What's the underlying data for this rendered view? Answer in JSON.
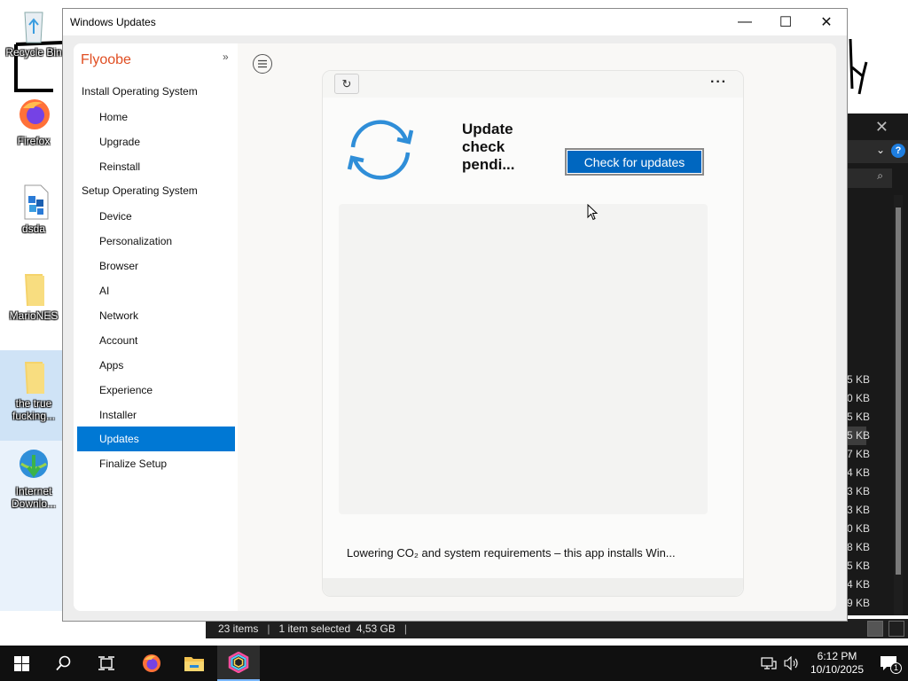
{
  "desktop": {
    "icons": [
      {
        "label": "Recycle Bin",
        "icon": "recycle-bin-icon"
      },
      {
        "label": "Firefox",
        "icon": "firefox-icon"
      },
      {
        "label": "dsda",
        "icon": "document-icon"
      },
      {
        "label": "MarioNES",
        "icon": "folder-icon"
      },
      {
        "label": "the true fucking...",
        "icon": "folder-icon"
      },
      {
        "label": "Internet Downlo...",
        "icon": "internet-download-manager-icon"
      }
    ]
  },
  "explorer": {
    "sizes": [
      "5 KB",
      "0 KB",
      "5 KB",
      "5 KB",
      "7 KB",
      "4 KB",
      "3 KB",
      "3 KB",
      "0 KB",
      "8 KB",
      "5 KB",
      "4 KB",
      "9 KB"
    ],
    "status": {
      "items": "23 items",
      "selected": "1 item selected  4,53 GB"
    }
  },
  "window": {
    "title": "Windows Updates",
    "controls": {
      "minimize": "—",
      "maximize": "☐",
      "close": "✕"
    }
  },
  "app": {
    "brand": "Flyoobe",
    "collapse": "»",
    "sections": [
      {
        "label": "Install Operating System",
        "items": [
          "Home",
          "Upgrade",
          "Reinstall"
        ]
      },
      {
        "label": "Setup Operating System",
        "items": [
          "Device",
          "Personalization",
          "Browser",
          "AI",
          "Network",
          "Account",
          "Apps",
          "Experience",
          "Installer",
          "Updates"
        ]
      }
    ],
    "finalize": "Finalize Setup",
    "active_item": "Updates",
    "update": {
      "status_title": "Update check pendi...",
      "check_button": "Check for updates",
      "refresh_glyph": "↻",
      "more_glyph": "···",
      "footer": "Lowering CO₂ and system requirements – this app installs Win..."
    }
  },
  "taskbar": {
    "apps": [
      "start-icon",
      "search-icon",
      "task-view-icon",
      "firefox-icon",
      "file-explorer-icon",
      "flyoobe-icon"
    ],
    "time": "6:12 PM",
    "date": "10/10/2025",
    "notification_count": "1"
  },
  "colors": {
    "accent": "#0078d4",
    "brand": "#e04e22",
    "button": "#0067c0",
    "sync_icon": "#2f8ed8"
  }
}
